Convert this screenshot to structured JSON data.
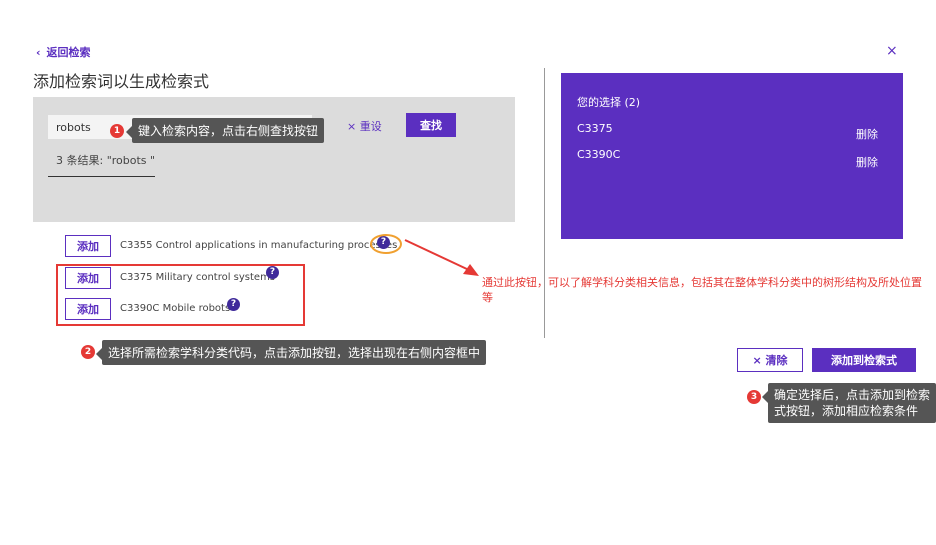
{
  "header": {
    "back_label": "返回检索",
    "title": "添加检索词以生成检索式",
    "close_label": "×"
  },
  "search": {
    "value": "robots",
    "reset_label": "× 重设",
    "find_label": "查找",
    "results_text": "3 条结果: \"robots \""
  },
  "callouts": {
    "step1": {
      "number": "1",
      "text": "键入检索内容，点击右侧查找按钮"
    },
    "step2": {
      "number": "2",
      "text": "选择所需检索学科分类代码，点击添加按钮，选择出现在右侧内容框中"
    },
    "step3": {
      "number": "3",
      "text": "确定选择后，点击添加到检索式按钮，添加相应检索条件"
    },
    "help_note": "通过此按钮，可以了解学科分类相关信息，包括其在整体学科分类中的树形结构及所处位置等"
  },
  "results": [
    {
      "add_label": "添加",
      "text": "C3355 Control applications in manufacturing processes",
      "help": "?"
    },
    {
      "add_label": "添加",
      "text": "C3375 Military control systems",
      "help": "?"
    },
    {
      "add_label": "添加",
      "text": "C3390C Mobile robots",
      "help": "?"
    }
  ],
  "selection": {
    "title": "您的选择 (2)",
    "items": [
      {
        "code": "C3375",
        "delete_label": "删除"
      },
      {
        "code": "C3390C",
        "delete_label": "删除"
      }
    ]
  },
  "actions": {
    "clear_label": "× 清除",
    "add_query_label": "添加到检索式"
  },
  "colors": {
    "accent": "#5b2fc0",
    "annotation_red": "#e53935",
    "tooltip": "#555555",
    "panel_gray": "#dcdcdc"
  }
}
